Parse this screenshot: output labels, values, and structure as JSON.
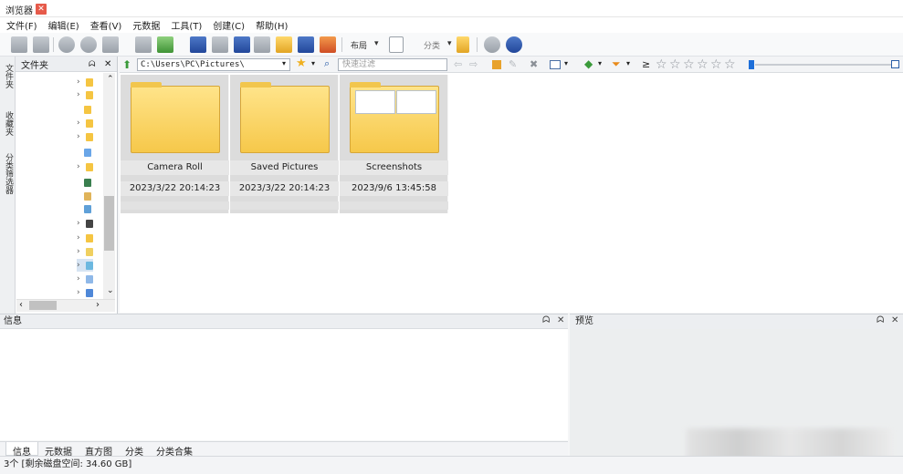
{
  "window": {
    "tab_title": "浏览器",
    "close_symbol": "✕"
  },
  "menubar": [
    "文件(F)",
    "编辑(E)",
    "查看(V)",
    "元数据",
    "工具(T)",
    "创建(C)",
    "帮助(H)"
  ],
  "toolbar": {
    "layout_label": "布局",
    "classify_label": "分类"
  },
  "side_tabs": [
    "文件夹",
    "收藏夹",
    "分类筛选器"
  ],
  "folder_panel": {
    "title": "文件夹",
    "pin": "ᗣ",
    "close": "✕"
  },
  "address": {
    "path": "C:\\Users\\PC\\Pictures\\",
    "filter_placeholder": "快速过滤"
  },
  "rating_symbol": "≥",
  "stars": [
    "☆",
    "☆",
    "☆",
    "☆",
    "☆",
    "☆"
  ],
  "items": [
    {
      "name": "Camera Roll",
      "date": "2023/3/22 20:14:23"
    },
    {
      "name": "Saved Pictures",
      "date": "2023/3/22 20:14:23"
    },
    {
      "name": "Screenshots",
      "date": "2023/9/6 13:45:58"
    }
  ],
  "info_panel": {
    "title": "信息",
    "pin": "ᗣ",
    "close": "✕"
  },
  "preview_panel": {
    "title": "预览",
    "pin": "ᗣ",
    "close": "✕"
  },
  "bottom_tabs": [
    "信息",
    "元数据",
    "直方图",
    "分类",
    "分类合集"
  ],
  "status": {
    "text": "3个 [剩余磁盘空间: 34.60 GB]"
  }
}
